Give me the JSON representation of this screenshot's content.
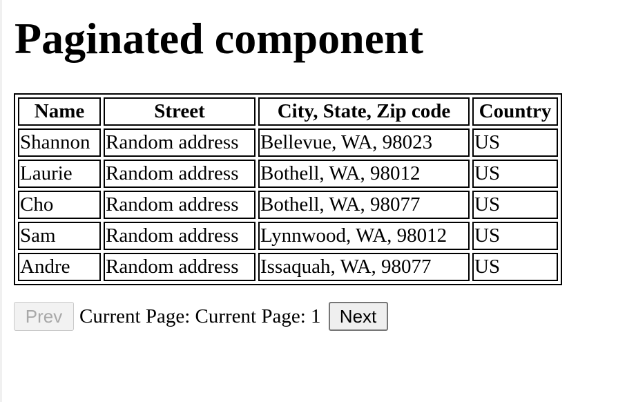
{
  "page": {
    "title": "Paginated component"
  },
  "table": {
    "headers": [
      "Name",
      "Street",
      "City, State, Zip code",
      "Country"
    ],
    "rows": [
      [
        "Shannon",
        "Random address",
        "Bellevue, WA, 98023",
        "US"
      ],
      [
        "Laurie",
        "Random address",
        "Bothell, WA, 98012",
        "US"
      ],
      [
        "Cho",
        "Random address",
        "Bothell, WA, 98077",
        "US"
      ],
      [
        "Sam",
        "Random address",
        "Lynnwood, WA, 98012",
        "US"
      ],
      [
        "Andre",
        "Random address",
        "Issaquah, WA, 98077",
        "US"
      ]
    ]
  },
  "pagination": {
    "prev_label": "Prev",
    "prev_disabled": true,
    "current_page_text": "Current Page: Current Page: 1",
    "next_label": "Next"
  }
}
